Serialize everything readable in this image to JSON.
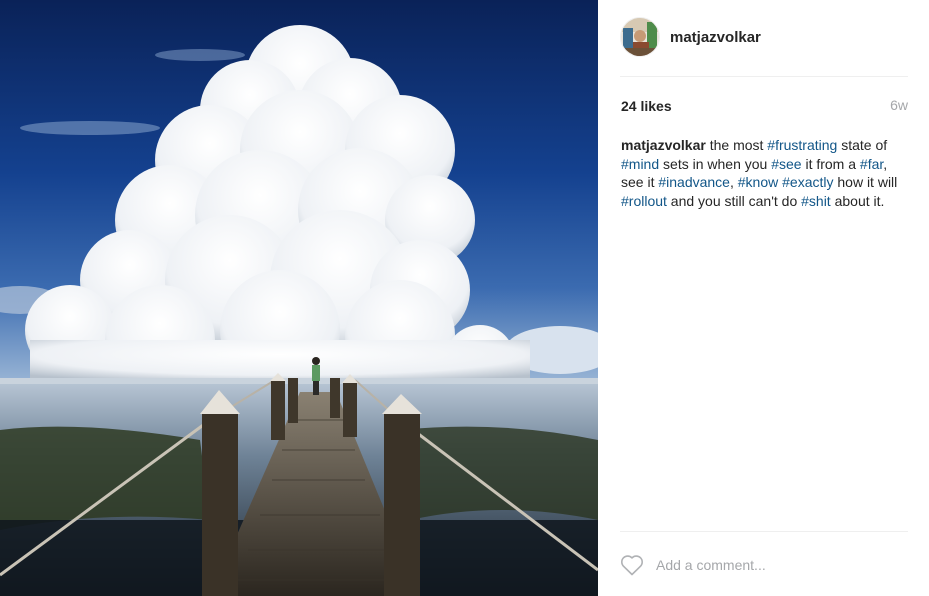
{
  "post": {
    "username": "matjazvolkar",
    "likes": "24 likes",
    "age": "6w",
    "caption": [
      {
        "type": "author",
        "text": "matjazvolkar"
      },
      {
        "type": "text",
        "text": " the most "
      },
      {
        "type": "tag",
        "text": "#frustrating"
      },
      {
        "type": "text",
        "text": " state of "
      },
      {
        "type": "tag",
        "text": "#mind"
      },
      {
        "type": "text",
        "text": " sets in when you "
      },
      {
        "type": "tag",
        "text": "#see"
      },
      {
        "type": "text",
        "text": " it from a "
      },
      {
        "type": "tag",
        "text": "#far"
      },
      {
        "type": "text",
        "text": ", see it "
      },
      {
        "type": "tag",
        "text": "#inadvance"
      },
      {
        "type": "text",
        "text": ", "
      },
      {
        "type": "tag",
        "text": "#know"
      },
      {
        "type": "text",
        "text": " "
      },
      {
        "type": "tag",
        "text": "#exactly"
      },
      {
        "type": "text",
        "text": " how it will "
      },
      {
        "type": "tag",
        "text": "#rollout"
      },
      {
        "type": "text",
        "text": " and you still can't do "
      },
      {
        "type": "tag",
        "text": "#shit"
      },
      {
        "type": "text",
        "text": " about it."
      }
    ]
  },
  "comment": {
    "placeholder": "Add a comment...",
    "like_icon": "heart-outline-icon"
  },
  "colors": {
    "hashtag": "#125688",
    "muted": "#a5a7aa",
    "divider": "#efefef"
  }
}
